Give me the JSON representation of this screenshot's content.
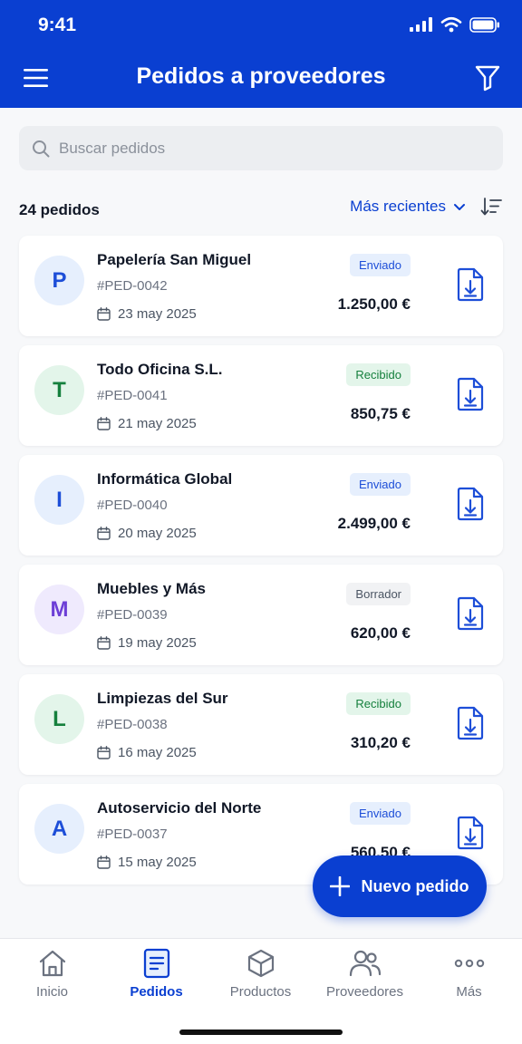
{
  "status_bar": {
    "time": "9:41"
  },
  "header": {
    "title": "Pedidos a proveedores"
  },
  "search": {
    "placeholder": "Buscar pedidos"
  },
  "toolbar": {
    "count_label": "24 pedidos",
    "sort_label": "Más recientes"
  },
  "orders": [
    {
      "initial": "P",
      "supplier": "Papelería San Miguel",
      "code": "#PED-0042",
      "date": "23 may 2025",
      "status": "Enviado",
      "amount": "1.250,00 €"
    },
    {
      "initial": "T",
      "supplier": "Todo Oficina S.L.",
      "code": "#PED-0041",
      "date": "21 may 2025",
      "status": "Recibido",
      "amount": "850,75 €"
    },
    {
      "initial": "I",
      "supplier": "Informática Global",
      "code": "#PED-0040",
      "date": "20 may 2025",
      "status": "Enviado",
      "amount": "2.499,00 €"
    },
    {
      "initial": "M",
      "supplier": "Muebles y Más",
      "code": "#PED-0039",
      "date": "19 may 2025",
      "status": "Borrador",
      "amount": "620,00 €"
    },
    {
      "initial": "L",
      "supplier": "Limpiezas del Sur",
      "code": "#PED-0038",
      "date": "16 may 2025",
      "status": "Recibido",
      "amount": "310,20 €"
    },
    {
      "initial": "A",
      "supplier": "Autoservicio del Norte",
      "code": "#PED-0037",
      "date": "15 may 2025",
      "status": "Enviado",
      "amount": "560,50 €"
    }
  ],
  "fab": {
    "label": "Nuevo pedido"
  },
  "tabs": [
    {
      "label": "Inicio",
      "icon": "home-icon",
      "active": false
    },
    {
      "label": "Pedidos",
      "icon": "document-icon",
      "active": true
    },
    {
      "label": "Productos",
      "icon": "box-icon",
      "active": false
    },
    {
      "label": "Proveedores",
      "icon": "users-icon",
      "active": false
    },
    {
      "label": "Más",
      "icon": "more-icon",
      "active": false
    }
  ],
  "colors": {
    "primary": "#0a3fd1",
    "sent_bg": "#e6effd",
    "sent_fg": "#1d4ed8",
    "received_bg": "#e3f5ea",
    "received_fg": "#15803d",
    "draft_bg": "#f1f2f4",
    "draft_fg": "#4b5563",
    "avatar_blue_bg": "#e6effd",
    "avatar_blue_fg": "#1d4ed8",
    "avatar_green_bg": "#e3f5ea",
    "avatar_green_fg": "#15803d",
    "avatar_purple_bg": "#efeafd",
    "avatar_purple_fg": "#6d3fd6"
  }
}
